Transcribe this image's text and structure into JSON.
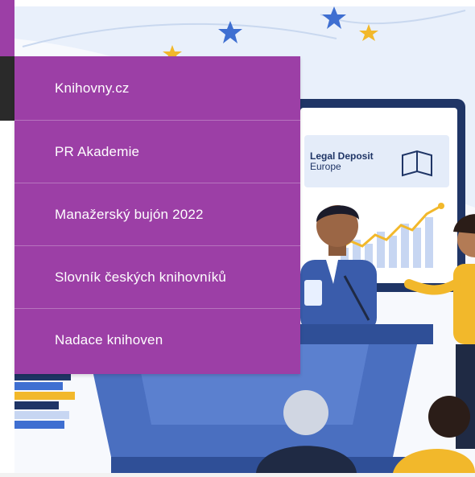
{
  "menu": {
    "items": [
      {
        "label": "Knihovny.cz"
      },
      {
        "label": "PR Akademie"
      },
      {
        "label": "Manažerský bujón 2022"
      },
      {
        "label": "Slovník českých knihovníků"
      },
      {
        "label": "Nadace knihoven"
      }
    ]
  },
  "illustration": {
    "sign_title_line1": "Legal Deposit",
    "sign_title_line2": "Europe"
  },
  "colors": {
    "menu_background": "#9c3fa6",
    "menu_text": "#ffffff",
    "stage_blue": "#4a6fc0",
    "sky": "#e9f0fb",
    "star_blue": "#3f6fd1",
    "star_yellow": "#f2b82b"
  }
}
